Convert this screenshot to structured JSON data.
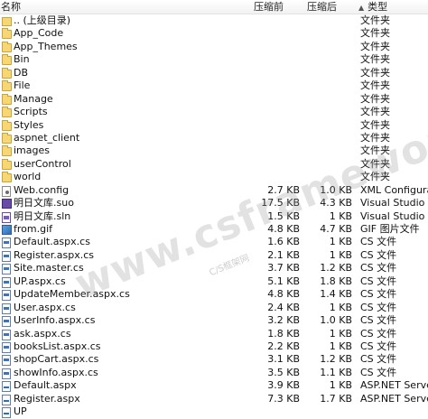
{
  "columns": {
    "name": "名称",
    "compressed": "压缩前",
    "uncompressed": "压缩后",
    "type": "类型",
    "sort_indicator": "▲"
  },
  "files": [
    {
      "name": ".. (上级目录)",
      "size1": "",
      "size2": "",
      "type": "文件夹",
      "icon": "folder-up-icon"
    },
    {
      "name": "App_Code",
      "size1": "",
      "size2": "",
      "type": "文件夹",
      "icon": "folder-icon"
    },
    {
      "name": "App_Themes",
      "size1": "",
      "size2": "",
      "type": "文件夹",
      "icon": "folder-icon"
    },
    {
      "name": "Bin",
      "size1": "",
      "size2": "",
      "type": "文件夹",
      "icon": "folder-icon"
    },
    {
      "name": "DB",
      "size1": "",
      "size2": "",
      "type": "文件夹",
      "icon": "folder-icon"
    },
    {
      "name": "File",
      "size1": "",
      "size2": "",
      "type": "文件夹",
      "icon": "folder-icon"
    },
    {
      "name": "Manage",
      "size1": "",
      "size2": "",
      "type": "文件夹",
      "icon": "folder-icon"
    },
    {
      "name": "Scripts",
      "size1": "",
      "size2": "",
      "type": "文件夹",
      "icon": "folder-icon"
    },
    {
      "name": "Styles",
      "size1": "",
      "size2": "",
      "type": "文件夹",
      "icon": "folder-icon"
    },
    {
      "name": "aspnet_client",
      "size1": "",
      "size2": "",
      "type": "文件夹",
      "icon": "folder-icon"
    },
    {
      "name": "images",
      "size1": "",
      "size2": "",
      "type": "文件夹",
      "icon": "folder-icon"
    },
    {
      "name": "userControl",
      "size1": "",
      "size2": "",
      "type": "文件夹",
      "icon": "folder-icon"
    },
    {
      "name": "world",
      "size1": "",
      "size2": "",
      "type": "文件夹",
      "icon": "folder-icon"
    },
    {
      "name": "Web.config",
      "size1": "2.7 KB",
      "size2": "1.0 KB",
      "type": "XML Configurati",
      "icon": "config-file-icon"
    },
    {
      "name": "明日文库.suo",
      "size1": "17.5 KB",
      "size2": "4.3 KB",
      "type": "Visual Studio Sc",
      "icon": "visual-studio-icon"
    },
    {
      "name": "明日文库.sln",
      "size1": "1.5 KB",
      "size2": "1 KB",
      "type": "Visual Studio Sc",
      "icon": "solution-file-icon"
    },
    {
      "name": "from.gif",
      "size1": "4.8 KB",
      "size2": "4.7 KB",
      "type": "GIF 图片文件",
      "icon": "gif-image-icon"
    },
    {
      "name": "Default.aspx.cs",
      "size1": "1.6 KB",
      "size2": "1 KB",
      "type": "CS 文件",
      "icon": "cs-file-icon"
    },
    {
      "name": "Register.aspx.cs",
      "size1": "2.1 KB",
      "size2": "1 KB",
      "type": "CS 文件",
      "icon": "cs-file-icon"
    },
    {
      "name": "Site.master.cs",
      "size1": "3.7 KB",
      "size2": "1.2 KB",
      "type": "CS 文件",
      "icon": "cs-file-icon"
    },
    {
      "name": "UP.aspx.cs",
      "size1": "5.1 KB",
      "size2": "1.8 KB",
      "type": "CS 文件",
      "icon": "cs-file-icon"
    },
    {
      "name": "UpdateMember.aspx.cs",
      "size1": "4.8 KB",
      "size2": "1.4 KB",
      "type": "CS 文件",
      "icon": "cs-file-icon"
    },
    {
      "name": "User.aspx.cs",
      "size1": "2.4 KB",
      "size2": "1 KB",
      "type": "CS 文件",
      "icon": "cs-file-icon"
    },
    {
      "name": "UserInfo.aspx.cs",
      "size1": "3.2 KB",
      "size2": "1.0 KB",
      "type": "CS 文件",
      "icon": "cs-file-icon"
    },
    {
      "name": "ask.aspx.cs",
      "size1": "1.8 KB",
      "size2": "1 KB",
      "type": "CS 文件",
      "icon": "cs-file-icon"
    },
    {
      "name": "booksList.aspx.cs",
      "size1": "2.2 KB",
      "size2": "1 KB",
      "type": "CS 文件",
      "icon": "cs-file-icon"
    },
    {
      "name": "shopCart.aspx.cs",
      "size1": "3.1 KB",
      "size2": "1.2 KB",
      "type": "CS 文件",
      "icon": "cs-file-icon"
    },
    {
      "name": "showInfo.aspx.cs",
      "size1": "3.5 KB",
      "size2": "1.1 KB",
      "type": "CS 文件",
      "icon": "cs-file-icon"
    },
    {
      "name": "Default.aspx",
      "size1": "3.9 KB",
      "size2": "1 KB",
      "type": "ASP.NET Server",
      "icon": "aspx-file-icon"
    },
    {
      "name": "Register.aspx",
      "size1": "7.3 KB",
      "size2": "1.7 KB",
      "type": "ASP.NET Server",
      "icon": "aspx-file-icon"
    },
    {
      "name": "UP",
      "size1": "",
      "size2": "",
      "type": "",
      "icon": "aspx-file-icon"
    }
  ],
  "watermark": {
    "text": "www.csframework.com",
    "sub": "C/S框架网"
  }
}
